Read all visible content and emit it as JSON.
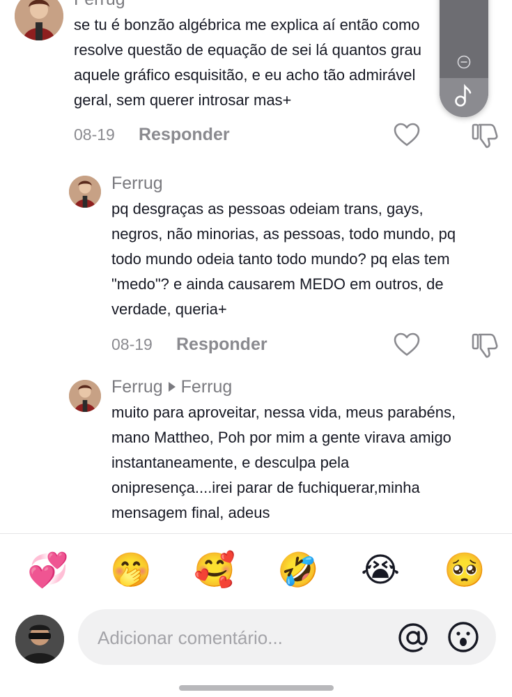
{
  "comments": [
    {
      "author": "Ferrug",
      "lines": [
        "se tu é bonzão algébrica me explica aí então como",
        "resolve questão de equação de sei lá quantos grau",
        "aquele gráfico esquisitão, e eu acho tão admirável",
        "geral, sem querer introsar mas+"
      ],
      "date": "08-19",
      "reply_label": "Responder"
    },
    {
      "author": "Ferrug",
      "lines": [
        "pq desgraças as pessoas odeiam trans, gays,",
        "negros, não minorias, as pessoas, todo mundo, pq",
        "todo mundo odeia tanto todo mundo? pq elas tem",
        "\"medo\"? e ainda causarem MEDO em outros, de",
        "verdade, queria+"
      ],
      "date": "08-19",
      "reply_label": "Responder"
    },
    {
      "author": "Ferrug",
      "reply_to": "Ferrug",
      "lines": [
        "muito para aproveitar, nessa vida, meus parabéns,",
        "mano Mattheo, Poh por mim a gente virava amigo",
        "instantaneamente, e desculpa pela",
        "onipresença....irei parar de fuchiquerar,minha",
        "mensagem final, adeus"
      ]
    }
  ],
  "quick_emojis": [
    "💞",
    "🤭",
    "🥰",
    "🤣",
    "😭",
    "🥺"
  ],
  "composer": {
    "placeholder": "Adicionar comentário...",
    "mention_icon": "at-sign-icon",
    "emoji_icon": "emoji-icon"
  },
  "colors": {
    "muted_text": "#7a7a7f",
    "input_bg": "#f1f1f2",
    "pill_bg": "#6d6d72"
  }
}
